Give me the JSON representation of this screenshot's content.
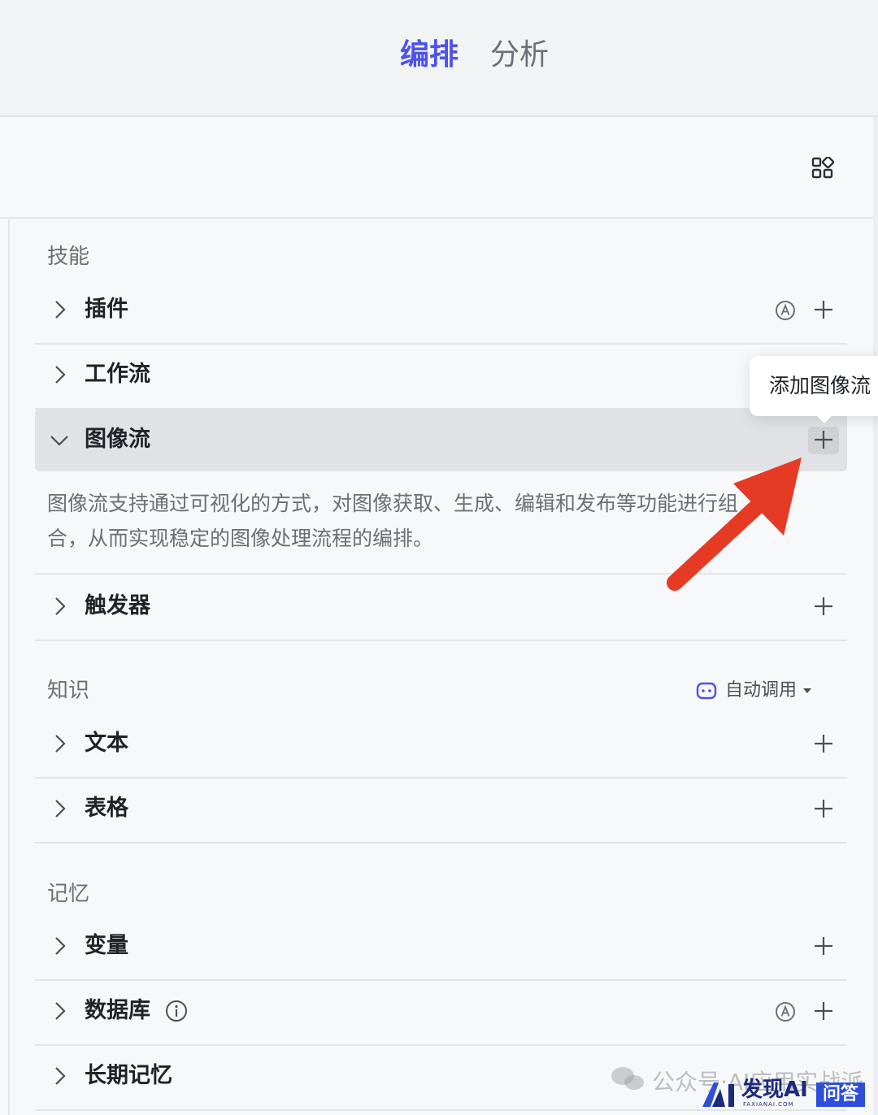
{
  "tabs": {
    "active": "编排",
    "idle": "分析"
  },
  "colors": {
    "accent": "#4d53e8",
    "arrow": "#e53b25",
    "row_expanded_bg": "#e1e2e5"
  },
  "icons": {
    "toolbar": "grid-apps-icon",
    "collapsed": "chevron-right-icon",
    "expanded": "chevron-down-icon",
    "add": "plus-icon",
    "auto": "auto-a-icon",
    "info": "info-icon",
    "robot": "robot-icon"
  },
  "skills": {
    "title": "技能",
    "items": [
      {
        "label": "插件",
        "expanded": false,
        "auto_badge": true
      },
      {
        "label": "工作流",
        "expanded": false,
        "auto_badge": false
      },
      {
        "label": "图像流",
        "expanded": true,
        "auto_badge": false,
        "description_line1": "图像流支持通过可视化的方式，对图像获取、生成、编辑和发布等功能进行组",
        "description_line2": "合，从而实现稳定的图像处理流程的编排。"
      },
      {
        "label": "触发器",
        "expanded": false,
        "auto_badge": false
      }
    ]
  },
  "knowledge": {
    "title": "知识",
    "auto_call": "自动调用",
    "items": [
      {
        "label": "文本"
      },
      {
        "label": "表格"
      }
    ]
  },
  "memory": {
    "title": "记忆",
    "items": [
      {
        "label": "变量"
      },
      {
        "label": "数据库",
        "has_info": true,
        "auto_badge": true
      },
      {
        "label": "长期记忆"
      }
    ]
  },
  "tooltip": {
    "text": "添加图像流"
  },
  "watermark": {
    "text": "公众号·AI应用实战派",
    "brand": "发现AI",
    "brand_domain": "FAXIANAI.COM",
    "badge": "问答"
  }
}
